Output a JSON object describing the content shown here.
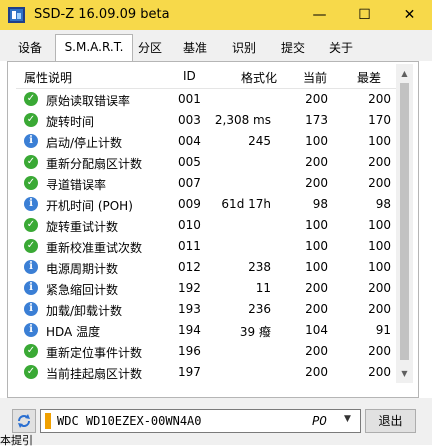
{
  "window": {
    "title": "SSD-Z 16.09.09 beta",
    "minimize": "—",
    "maximize": "☐",
    "close": "✕"
  },
  "tabs": [
    "设备",
    "S.M.A.R.T.",
    "分区",
    "基准",
    "识别",
    "提交",
    "关于"
  ],
  "active_tab": "S.M.A.R.T.",
  "columns": {
    "name": "属性说明",
    "id": "ID",
    "formatted": "格式化",
    "current": "当前",
    "worst": "最差"
  },
  "rows": [
    {
      "status": "ok",
      "name": "原始读取错误率",
      "id": "001",
      "formatted": "",
      "current": "200",
      "worst": "200"
    },
    {
      "status": "ok",
      "name": "旋转时间",
      "id": "003",
      "formatted": "2,308 ms",
      "current": "173",
      "worst": "170"
    },
    {
      "status": "info",
      "name": "启动/停止计数",
      "id": "004",
      "formatted": "245",
      "current": "100",
      "worst": "100"
    },
    {
      "status": "ok",
      "name": "重新分配扇区计数",
      "id": "005",
      "formatted": "",
      "current": "200",
      "worst": "200"
    },
    {
      "status": "ok",
      "name": "寻道错误率",
      "id": "007",
      "formatted": "",
      "current": "200",
      "worst": "200"
    },
    {
      "status": "info",
      "name": "开机时间 (POH)",
      "id": "009",
      "formatted": "61d 17h",
      "current": "98",
      "worst": "98"
    },
    {
      "status": "ok",
      "name": "旋转重试计数",
      "id": "010",
      "formatted": "",
      "current": "100",
      "worst": "100"
    },
    {
      "status": "ok",
      "name": "重新校准重试次数",
      "id": "011",
      "formatted": "",
      "current": "100",
      "worst": "100"
    },
    {
      "status": "info",
      "name": "电源周期计数",
      "id": "012",
      "formatted": "238",
      "current": "100",
      "worst": "100"
    },
    {
      "status": "info",
      "name": "紧急缩回计数",
      "id": "192",
      "formatted": "11",
      "current": "200",
      "worst": "200"
    },
    {
      "status": "info",
      "name": "加载/卸载计数",
      "id": "193",
      "formatted": "236",
      "current": "200",
      "worst": "200"
    },
    {
      "status": "info",
      "name": "HDA 温度",
      "id": "194",
      "formatted": "39 癈",
      "current": "104",
      "worst": "91"
    },
    {
      "status": "ok",
      "name": "重新定位事件计数",
      "id": "196",
      "formatted": "",
      "current": "200",
      "worst": "200"
    },
    {
      "status": "ok",
      "name": "当前挂起扇区计数",
      "id": "197",
      "formatted": "",
      "current": "200",
      "worst": "200"
    }
  ],
  "drive": {
    "name": "WDC WD10EZEX-00WN4A0",
    "port": "P0",
    "color": "#f0a000"
  },
  "exit_label": "退出",
  "left_edge_text": "本提引",
  "status_icons": {
    "ok": "✓",
    "info": "i"
  }
}
